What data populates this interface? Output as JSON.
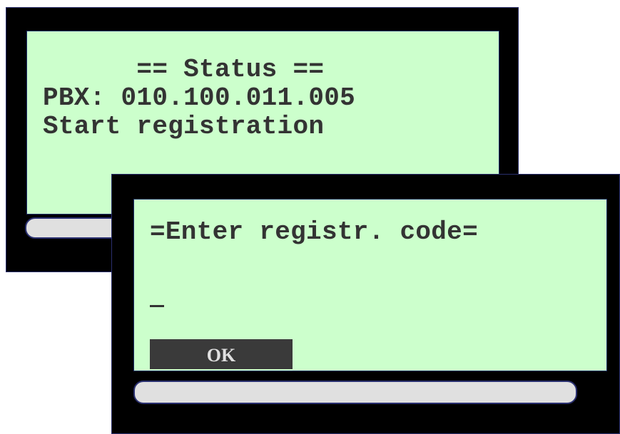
{
  "status_screen": {
    "title": "      == Status ==",
    "pbx_line": "PBX: 010.100.011.005",
    "message": "Start registration"
  },
  "registration_dialog": {
    "title": "=Enter registr. code=",
    "code_value": "",
    "ok_label": "OK"
  },
  "colors": {
    "lcd_background": "#ccffcc",
    "lcd_text": "#333333",
    "device_body": "#000000",
    "button_background": "#3a3a3a"
  }
}
